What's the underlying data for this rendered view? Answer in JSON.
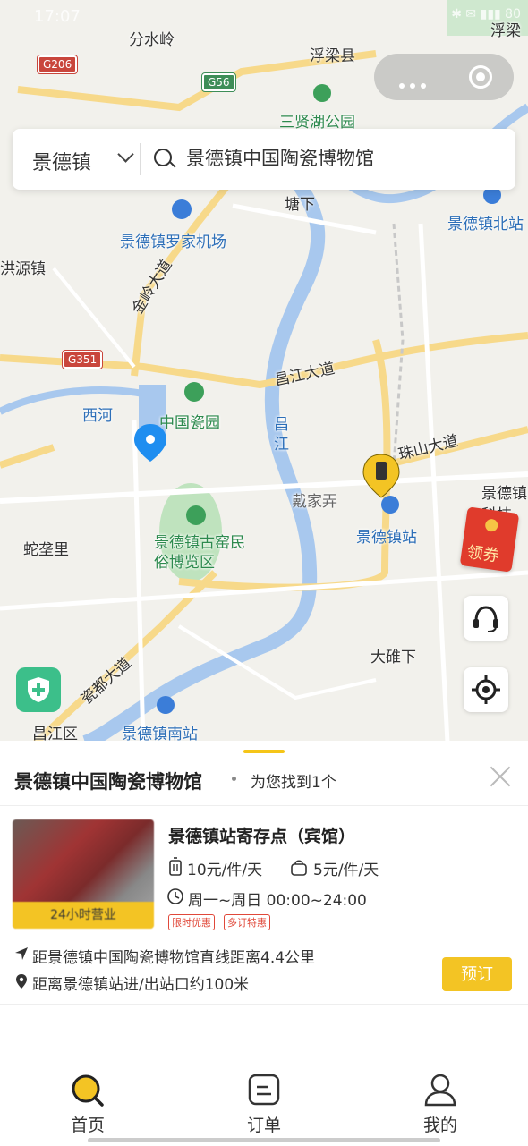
{
  "status_bar": {
    "time": "17:07",
    "icons": "✱ ✉ ▮▮▮ 80"
  },
  "map": {
    "labels": {
      "fenshuiling": "分水岭",
      "fuliangxian": "浮梁县",
      "sanxianhu": "三贤湖公园",
      "tangxia": "塘下",
      "jdz_north": "景德镇北站",
      "airport": "景德镇罗家机场",
      "hongyuanzhen": "洪源镇",
      "jinling": "金岭大道",
      "changjiang_rd": "昌江大道",
      "xihe": "西河",
      "china_ceramic_park": "中国瓷园",
      "changjiang_river": "昌江",
      "zhushan": "珠山大道",
      "daijianong": "戴家弄",
      "jdz_station": "景德镇站",
      "jdz_tech": "景德镇科技",
      "shejili": "蛇垄里",
      "gu_yao": "景德镇古窑民俗博览区",
      "cidu": "瓷都大道",
      "dalei": "大碓下",
      "changjiangqu": "昌江区",
      "jdz_south": "景德镇南站",
      "fuliang_top": "浮梁"
    },
    "road_badges": {
      "g206": "G206",
      "g56": "G56",
      "g351": "G351"
    },
    "coupon_label": "领券",
    "colors": {
      "water": "#a8c8ee",
      "road_major": "#f7d98a",
      "road_minor": "#ffffff",
      "green": "#c9e8c7"
    }
  },
  "search": {
    "city": "景德镇",
    "query": "景德镇中国陶瓷博物馆"
  },
  "panel": {
    "title": "景德镇中国陶瓷博物馆",
    "count_text": "为您找到1个",
    "item": {
      "name": "景德镇站寄存点（宾馆）",
      "badge": "24小时营业",
      "price_large": "10元/件/天",
      "price_small": "5元/件/天",
      "hours": "周一~周日 00:00~24:00",
      "tags": [
        "限时优惠",
        "多订特惠"
      ],
      "distance": "距景德镇中国陶瓷博物馆直线距离4.4公里",
      "exit_distance": "距离景德镇站进/出站口约100米",
      "book_label": "预订"
    }
  },
  "tabbar": {
    "items": [
      {
        "label": "首页"
      },
      {
        "label": "订单"
      },
      {
        "label": "我的"
      }
    ]
  },
  "accent_color": "#f3c424"
}
